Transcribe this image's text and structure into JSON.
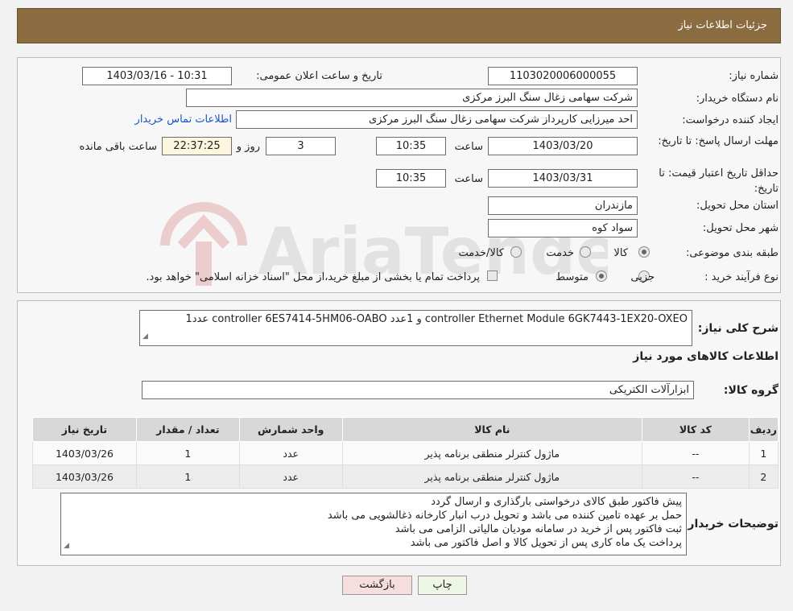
{
  "header": {
    "title": "جزئیات اطلاعات نیاز"
  },
  "form": {
    "need_number_label": "شماره نیاز:",
    "need_number": "1103020006000055",
    "announce_label": "تاریخ و ساعت اعلان عمومی:",
    "announce_value": "1403/03/16 - 10:31",
    "buyer_org_label": "نام دستگاه خریدار:",
    "buyer_org": "شرکت سهامی زغال سنگ البرز مرکزی",
    "requester_label": "ایجاد کننده درخواست:",
    "requester": "احد میرزایی کارپرداز شرکت سهامی زغال سنگ البرز مرکزی",
    "contact_link": "اطلاعات تماس خریدار",
    "reply_deadline_label": "مهلت ارسال پاسخ: تا تاریخ:",
    "reply_date": "1403/03/20",
    "time_label": "ساعت",
    "reply_time": "10:35",
    "days_value": "3",
    "days_label": "روز و",
    "remaining_time": "22:37:25",
    "remaining_label": "ساعت باقی مانده",
    "validity_label": "حداقل تاریخ اعتبار قیمت: تا تاریخ:",
    "validity_date": "1403/03/31",
    "validity_time": "10:35",
    "province_label": "استان محل تحویل:",
    "province": "مازندران",
    "city_label": "شهر محل تحویل:",
    "city": "سواد کوه",
    "category_label": "طبقه بندی موضوعی:",
    "category_options": [
      "کالا",
      "خدمت",
      "کالا/خدمت"
    ],
    "process_label": "نوع فرآیند خرید :",
    "process_options": [
      "جزیی",
      "متوسط"
    ],
    "payment_note": "پرداخت تمام یا بخشی از مبلغ خرید،از محل \"اسناد خزانه اسلامی\" خواهد بود."
  },
  "description": {
    "label": "شرح کلی نیاز:",
    "text": "1عدد controller 6ES7414-5HM06-OABO و 1عدد controller Ethernet Module 6GK7443-1EX20-OXEO"
  },
  "goods": {
    "section_title": "اطلاعات کالاهای مورد نیاز",
    "group_label": "گروه کالا:",
    "group_value": "ابزارآلات الکتریکی",
    "columns": [
      "ردیف",
      "کد کالا",
      "نام کالا",
      "واحد شمارش",
      "تعداد / مقدار",
      "تاریخ نیاز"
    ],
    "rows": [
      [
        "1",
        "--",
        "ماژول کنترلر منطقی برنامه پذیر",
        "عدد",
        "1",
        "1403/03/26"
      ],
      [
        "2",
        "--",
        "ماژول کنترلر منطقی برنامه پذیر",
        "عدد",
        "1",
        "1403/03/26"
      ]
    ]
  },
  "buyer_notes": {
    "label": "توضیحات خریدار:",
    "lines": [
      "پیش فاکتور طبق کالای درخواستی بارگذاری و ارسال گردد",
      "حمل بر عهده تامین کننده می باشد و تحویل درب انبار کارخانه ذغالشویی می باشد",
      "ثبت فاکتور پس از خرید در سامانه مودیان مالیاتی الزامی می باشد",
      "پرداخت یک ماه کاری پس از تحویل کالا و اصل فاکتور می باشد"
    ]
  },
  "buttons": {
    "print": "چاپ",
    "back": "بازگشت"
  },
  "watermark": {
    "text": "AriaTender.neT"
  }
}
